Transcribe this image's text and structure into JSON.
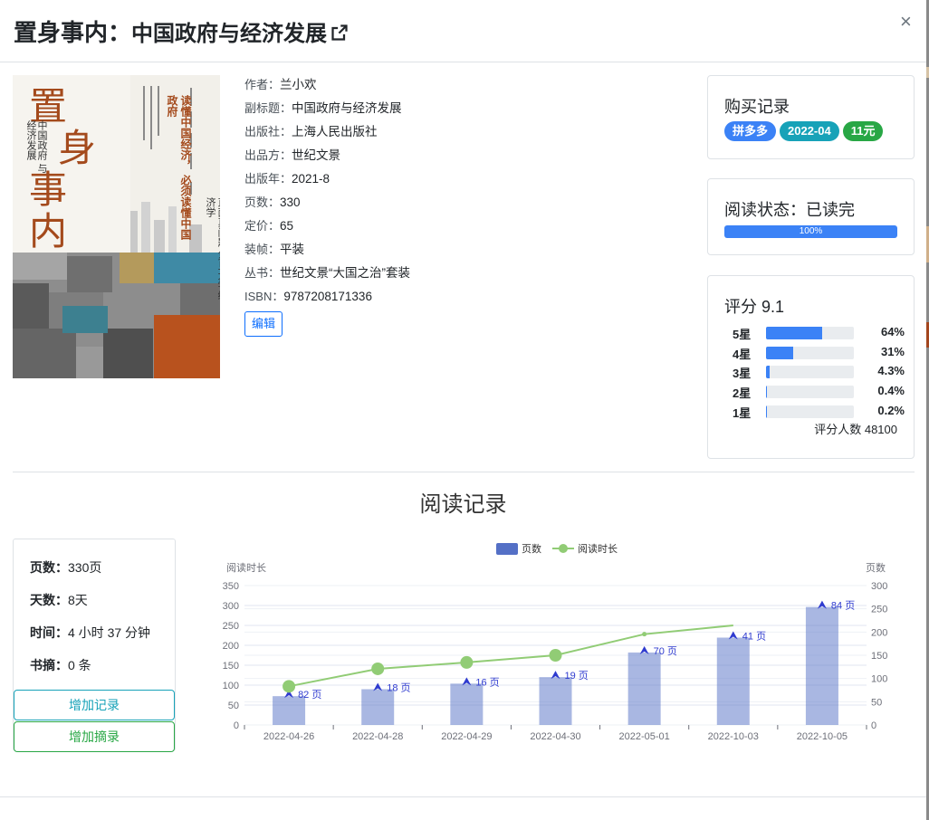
{
  "header": {
    "title_main": "置身事内",
    "title_sep": "：",
    "title_sub": "中国政府与经济发展",
    "close_label": "×"
  },
  "cover": {
    "title_chars": [
      "置",
      "身",
      "事",
      "内"
    ],
    "subtitle_lines": [
      "中国政府",
      "与经济发展"
    ],
    "slogan_lines": [
      "读懂中国经济，",
      "必须读懂中国政府"
    ],
    "author_mark": "兰小欢 著"
  },
  "info": {
    "rows": [
      {
        "label": "作者：",
        "value": "兰小欢"
      },
      {
        "label": "副标题：",
        "value": "中国政府与经济发展"
      },
      {
        "label": "出版社：",
        "value": "上海人民出版社"
      },
      {
        "label": "出品方：",
        "value": "世纪文景"
      },
      {
        "label": "出版年：",
        "value": "2021-8"
      },
      {
        "label": "页数：",
        "value": "330"
      },
      {
        "label": "定价：",
        "value": "65"
      },
      {
        "label": "装帧：",
        "value": "平装"
      },
      {
        "label": "丛书：",
        "value": "世纪文景“大国之治”套装"
      },
      {
        "label": "ISBN：",
        "value": "9787208171336"
      }
    ],
    "edit_label": "编辑"
  },
  "purchase": {
    "title": "购买记录",
    "badges": [
      {
        "text": "拼多多",
        "color": "#3b82f6"
      },
      {
        "text": "2022-04",
        "color": "#17a2b8"
      },
      {
        "text": "11元",
        "color": "#28a745"
      }
    ]
  },
  "reading_status": {
    "title": "阅读状态：已读完",
    "progress": 100,
    "progress_label": "100%"
  },
  "rating": {
    "title": "评分 9.1",
    "rows": [
      {
        "label": "5星",
        "pct": 64,
        "pct_label": "64%"
      },
      {
        "label": "4星",
        "pct": 31,
        "pct_label": "31%"
      },
      {
        "label": "3星",
        "pct": 4.3,
        "pct_label": "4.3%"
      },
      {
        "label": "2星",
        "pct": 0.4,
        "pct_label": "0.4%"
      },
      {
        "label": "1星",
        "pct": 0.2,
        "pct_label": "0.2%"
      }
    ],
    "count_label": "评分人数 48100"
  },
  "records": {
    "section_title": "阅读记录",
    "stats": [
      {
        "label": "页数：",
        "value": "330页"
      },
      {
        "label": "天数：",
        "value": "8天"
      },
      {
        "label": "时间：",
        "value": "4 小时 37 分钟"
      },
      {
        "label": "书摘：",
        "value": "0 条"
      }
    ],
    "add_record_label": "增加记录",
    "add_excerpt_label": "增加摘录"
  },
  "chart_data": {
    "type": "bar",
    "categories": [
      "2022-04-26",
      "2022-04-28",
      "2022-04-29",
      "2022-04-30",
      "2022-05-01",
      "2022-10-03",
      "2022-10-05"
    ],
    "series": [
      {
        "name": "页数",
        "type": "bar",
        "axis": "right",
        "values": [
          62,
          77,
          89,
          103,
          156,
          188,
          254
        ],
        "labels": [
          "82 页",
          "18 页",
          "16 页",
          "19 页",
          "70 页",
          "41 页",
          "84 页"
        ],
        "color": "#5470c6"
      },
      {
        "name": "阅读时长",
        "type": "line",
        "axis": "left",
        "values": [
          97,
          141,
          157,
          175,
          228,
          250,
          null
        ],
        "color": "#91cc75"
      }
    ],
    "ylabel_left": "阅读时长",
    "ylabel_right": "页数",
    "yticks_left": [
      0,
      50,
      100,
      150,
      200,
      250,
      300,
      350
    ],
    "yticks_right": [
      0,
      50,
      100,
      150,
      200,
      250,
      300
    ],
    "ylim_left": [
      0,
      350
    ],
    "ylim_right": [
      0,
      300
    ],
    "legend": "top-center"
  }
}
